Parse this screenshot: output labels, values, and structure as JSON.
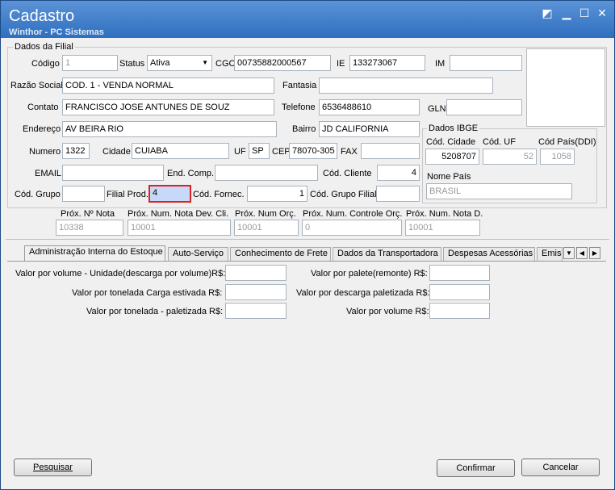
{
  "window": {
    "title": "Cadastro",
    "subtitle": "Winthor - PC Sistemas"
  },
  "group_filial": {
    "title": "Dados da Filial"
  },
  "fields": {
    "codigo": {
      "label": "Código",
      "value": "1"
    },
    "status": {
      "label": "Status",
      "value": "Ativa"
    },
    "cgc": {
      "label": "CGC",
      "value": "00735882000567"
    },
    "ie": {
      "label": "IE",
      "value": "133273067"
    },
    "im": {
      "label": "IM",
      "value": ""
    },
    "razao_social": {
      "label": "Razão Social",
      "value": "COD. 1 - VENDA NORMAL"
    },
    "fantasia": {
      "label": "Fantasia",
      "value": ""
    },
    "contato": {
      "label": "Contato",
      "value": "FRANCISCO JOSE ANTUNES DE SOUZ"
    },
    "telefone": {
      "label": "Telefone",
      "value": "6536488610"
    },
    "gln": {
      "label": "GLN",
      "value": ""
    },
    "endereco": {
      "label": "Endereço",
      "value": "AV BEIRA RIO"
    },
    "bairro": {
      "label": "Bairro",
      "value": "JD CALIFORNIA"
    },
    "numero": {
      "label": "Numero",
      "value": "1322"
    },
    "cidade": {
      "label": "Cidade",
      "value": "CUIABA"
    },
    "uf": {
      "label": "UF",
      "value": "SP"
    },
    "cep": {
      "label": "CEP",
      "value": "78070-305"
    },
    "fax": {
      "label": "FAX",
      "value": ""
    },
    "email": {
      "label": "EMAIL",
      "value": ""
    },
    "end_comp": {
      "label": "End. Comp.",
      "value": ""
    },
    "cod_cliente": {
      "label": "Cód. Cliente",
      "value": "4"
    },
    "cod_grupo": {
      "label": "Cód. Grupo",
      "value": ""
    },
    "filial_prod": {
      "label": "Filial Prod.",
      "value": "4"
    },
    "cod_fornec": {
      "label": "Cód. Fornec.",
      "value": "1"
    },
    "cod_grupo_filial": {
      "label": "Cód. Grupo Filial",
      "value": ""
    },
    "prox_nota": {
      "label": "Próx. Nº Nota",
      "value": "10338"
    },
    "prox_nota_dev": {
      "label": "Próx. Num. Nota Dev. Cli.",
      "value": "10001"
    },
    "prox_num_orc": {
      "label": "Próx. Num Orç.",
      "value": "10001"
    },
    "prox_controle_orc": {
      "label": "Próx. Num. Controle Orç.",
      "value": "0"
    },
    "prox_nota_d": {
      "label": "Próx. Num. Nota D.",
      "value": "10001"
    }
  },
  "ibge": {
    "title": "Dados IBGE",
    "cod_cidade": {
      "label": "Cód. Cidade",
      "value": "5208707"
    },
    "cod_uf": {
      "label": "Cód. UF",
      "value": "52"
    },
    "cod_pais": {
      "label": "Cód País(DDI)",
      "value": "1058"
    },
    "nome_pais": {
      "label": "Nome País",
      "value": "BRASIL"
    }
  },
  "tabs": [
    {
      "label": "Administração Interna do Estoque"
    },
    {
      "label": "Auto-Serviço"
    },
    {
      "label": "Conhecimento de Frete"
    },
    {
      "label": "Dados da Transportadora"
    },
    {
      "label": "Despesas Acessórias"
    },
    {
      "label": "Emiss"
    }
  ],
  "tab_content": {
    "vol_descarga": {
      "label": "Valor por volume - Unidade(descarga por volume)R$:",
      "value": ""
    },
    "ton_estivada": {
      "label": "Valor por tonelada Carga estivada R$:",
      "value": ""
    },
    "ton_paletizada": {
      "label": "Valor por tonelada - paletizada R$:",
      "value": ""
    },
    "palete_remonte": {
      "label": "Valor por palete(remonte) R$:",
      "value": ""
    },
    "descarga_paletizada": {
      "label": "Valor por descarga paletizada R$:",
      "value": ""
    },
    "por_volume": {
      "label": "Valor por volume R$:",
      "value": ""
    }
  },
  "buttons": {
    "pesquisar": "Pesquisar",
    "confirmar": "Confirmar",
    "cancelar": "Cancelar"
  },
  "colors": {
    "titlebar": "#3a78c8",
    "highlight_border": "#e02020",
    "highlight_fill": "#c8d8f8"
  }
}
